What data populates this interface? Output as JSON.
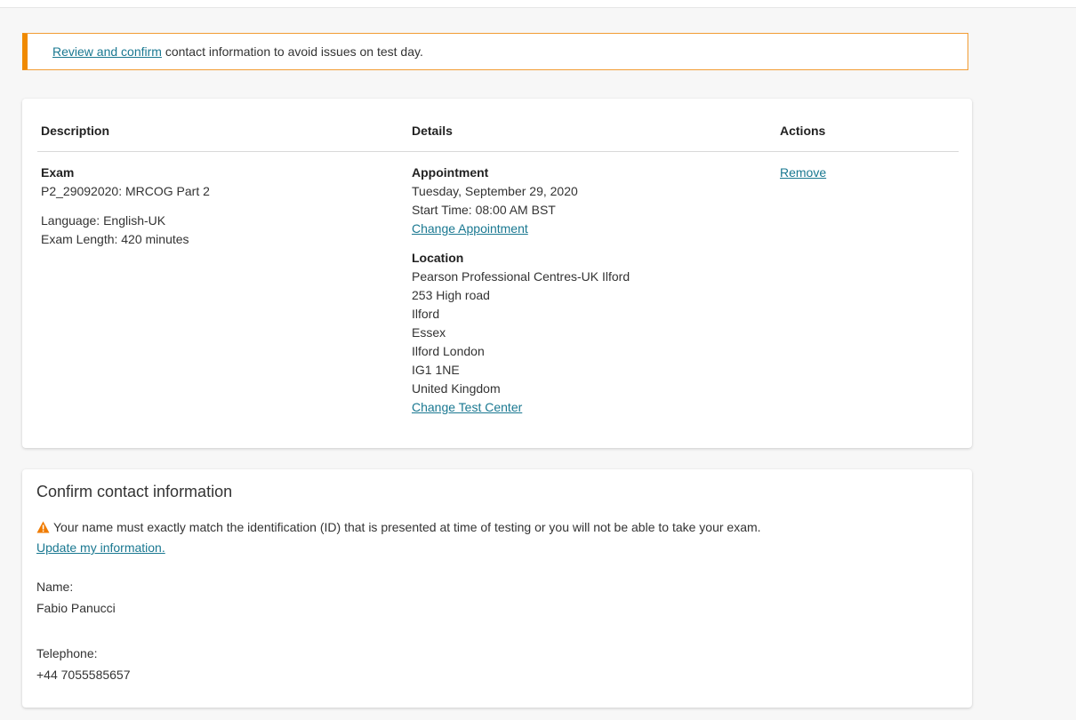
{
  "alert": {
    "link_text": "Review and confirm",
    "text": " contact information to avoid issues on test day."
  },
  "order_table": {
    "headers": {
      "description": "Description",
      "details": "Details",
      "actions": "Actions"
    },
    "exam": {
      "heading": "Exam",
      "name": "P2_29092020: MRCOG Part 2",
      "language": "Language: English-UK",
      "length": "Exam Length: 420 minutes"
    },
    "appointment": {
      "heading": "Appointment",
      "date": "Tuesday, September 29, 2020",
      "start_time": "Start Time: 08:00 AM BST",
      "change_link": "Change Appointment"
    },
    "location": {
      "heading": "Location",
      "lines": [
        "Pearson Professional Centres-UK Ilford",
        "253 High road",
        "Ilford",
        "Essex",
        "Ilford London",
        "IG1 1NE",
        "United Kingdom"
      ],
      "change_link": "Change Test Center"
    },
    "actions": {
      "remove_link": "Remove"
    }
  },
  "contact": {
    "title": "Confirm contact information",
    "warning": "Your name must exactly match the identification (ID) that is presented at time of testing or you will not be able to take your exam.",
    "update_link": "Update my information.",
    "name_label": "Name:",
    "name_value": "Fabio Panucci",
    "phone_label": "Telephone:",
    "phone_value": "+44 7055585657"
  },
  "colors": {
    "link": "#1a7891",
    "alert_border": "#f08a00",
    "warning_icon": "#f07b00"
  }
}
